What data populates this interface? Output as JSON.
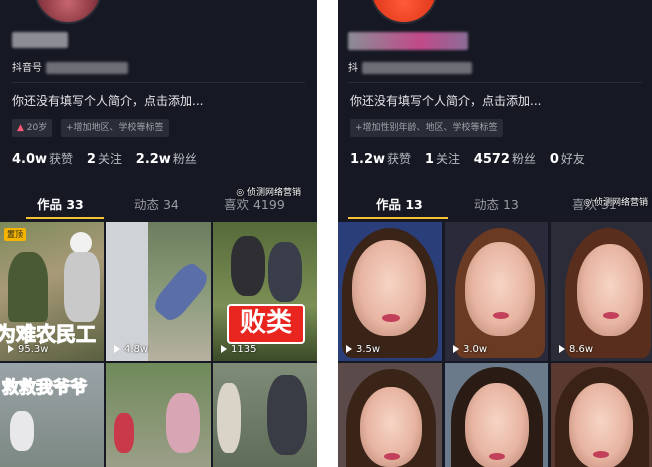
{
  "left": {
    "id_prefix": "抖音号",
    "bio": "你还没有填写个人简介，点击添加...",
    "tags": [
      "20岁",
      "+增加地区、学校等标签"
    ],
    "stats": [
      {
        "value": "4.0w",
        "label": "获赞"
      },
      {
        "value": "2",
        "label": "关注"
      },
      {
        "value": "2.2w",
        "label": "粉丝"
      }
    ],
    "tabs": [
      {
        "label": "作品 33",
        "active": true
      },
      {
        "label": "动态 34",
        "active": false
      },
      {
        "label": "喜欢 4199",
        "active": false
      }
    ],
    "pinned_badge": "置顶",
    "videos": [
      {
        "views": "95.3w",
        "overlay": "为难农民工"
      },
      {
        "views": "4.8w",
        "overlay": ""
      },
      {
        "views": "1135",
        "overlay": "败类"
      },
      {
        "views": "",
        "overlay": "救救我爷爷"
      },
      {
        "views": "",
        "overlay": ""
      },
      {
        "views": "",
        "overlay": ""
      }
    ]
  },
  "right": {
    "id_prefix": "抖",
    "bio": "你还没有填写个人简介，点击添加...",
    "tags": [
      "+增加性别年龄、地区、学校等标签"
    ],
    "stats": [
      {
        "value": "1.2w",
        "label": "获赞"
      },
      {
        "value": "1",
        "label": "关注"
      },
      {
        "value": "4572",
        "label": "粉丝"
      },
      {
        "value": "0",
        "label": "好友"
      }
    ],
    "tabs": [
      {
        "label": "作品 13",
        "active": true
      },
      {
        "label": "动态 13",
        "active": false
      },
      {
        "label": "喜欢 31",
        "active": false
      }
    ],
    "videos": [
      {
        "views": "3.5w"
      },
      {
        "views": "3.0w"
      },
      {
        "views": "8.6w"
      },
      {
        "views": ""
      },
      {
        "views": ""
      },
      {
        "views": ""
      }
    ]
  },
  "watermark": "侦测网络营销",
  "colors": {
    "bg": "#161823",
    "accent": "#f6c333",
    "red_overlay": "#e8261f"
  }
}
